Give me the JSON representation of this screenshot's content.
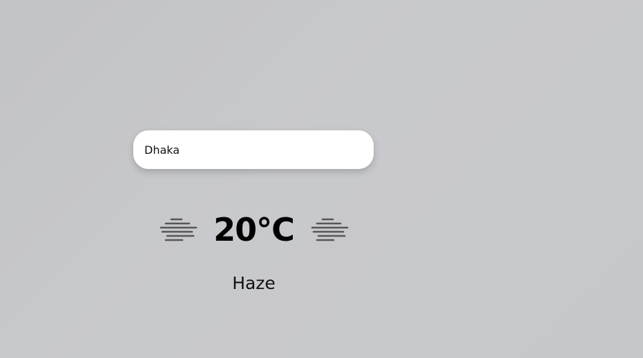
{
  "search": {
    "value": "Dhaka",
    "placeholder": ""
  },
  "weather": {
    "temperature": "20°C",
    "condition": "Haze",
    "icon_left": "haze-icon",
    "icon_right": "haze-icon"
  },
  "colors": {
    "background": "#c6c7ca",
    "card": "#ffffff",
    "icon": "#555555",
    "text": "#000000"
  }
}
